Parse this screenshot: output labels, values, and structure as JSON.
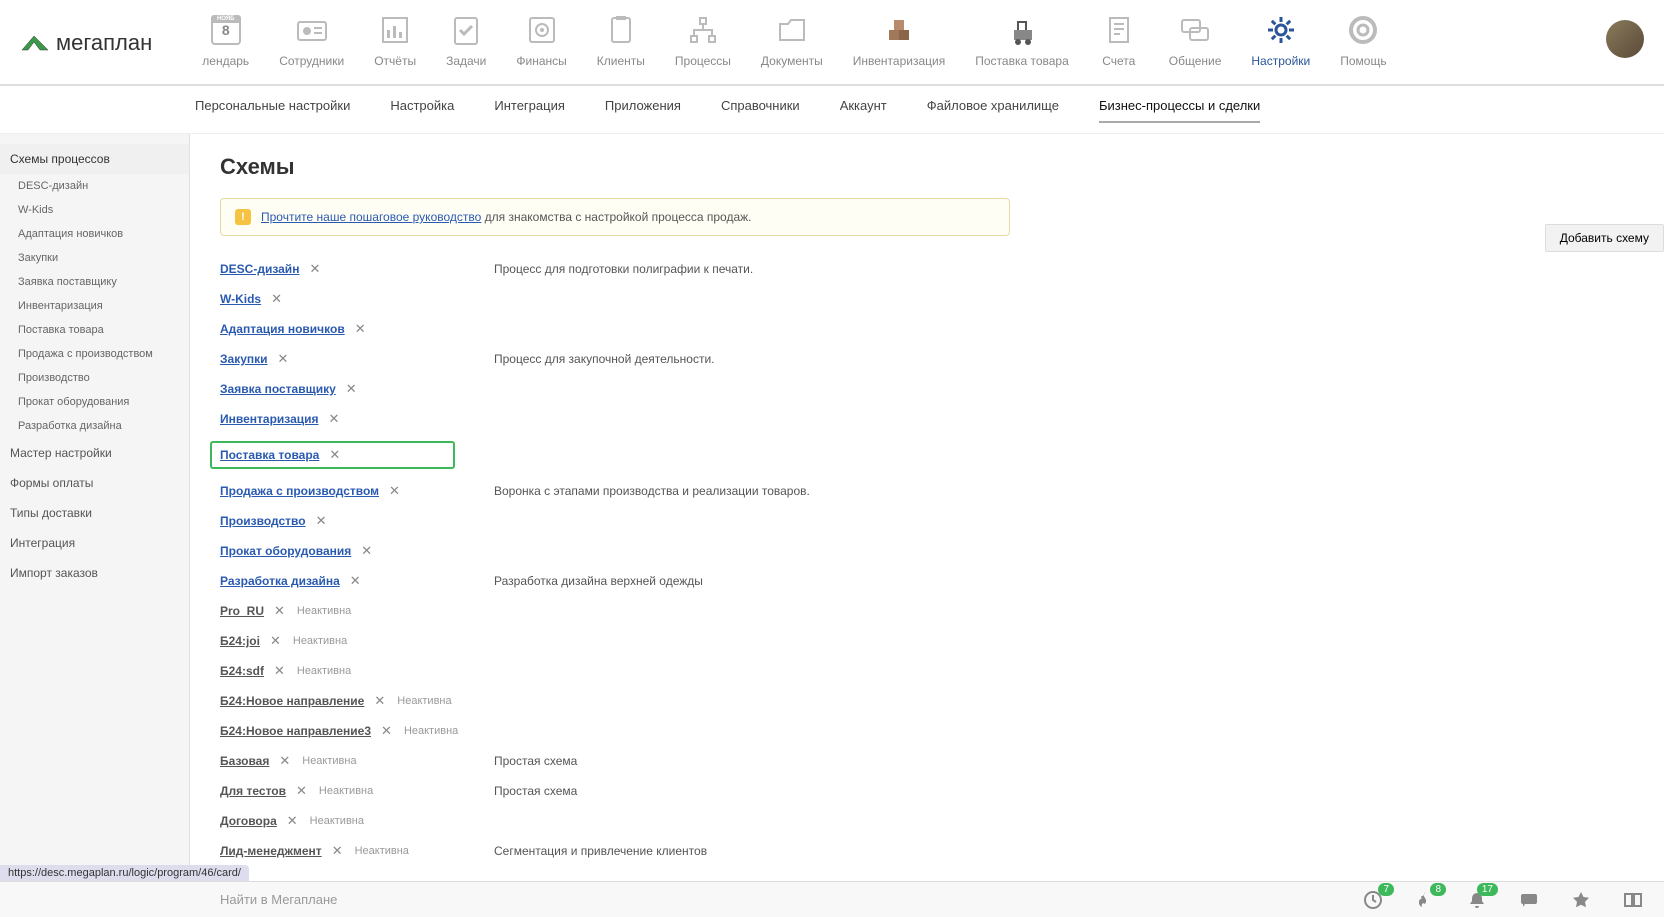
{
  "logo_text": "мегаплан",
  "topnav": [
    {
      "label": "лендарь",
      "icon": "calendar",
      "day": "8"
    },
    {
      "label": "Сотрудники",
      "icon": "badge"
    },
    {
      "label": "Отчёты",
      "icon": "chart"
    },
    {
      "label": "Задачи",
      "icon": "check"
    },
    {
      "label": "Финансы",
      "icon": "safe"
    },
    {
      "label": "Клиенты",
      "icon": "book"
    },
    {
      "label": "Процессы",
      "icon": "tree"
    },
    {
      "label": "Документы",
      "icon": "folder"
    },
    {
      "label": "Инвентаризация",
      "icon": "boxes"
    },
    {
      "label": "Поставка товара",
      "icon": "cart"
    },
    {
      "label": "Счета",
      "icon": "bill"
    },
    {
      "label": "Общение",
      "icon": "chat"
    },
    {
      "label": "Настройки",
      "icon": "gear",
      "active": true
    },
    {
      "label": "Помощь",
      "icon": "help"
    }
  ],
  "subnav": [
    "Персональные настройки",
    "Настройка",
    "Интеграция",
    "Приложения",
    "Справочники",
    "Аккаунт",
    "Файловое хранилище",
    "Бизнес-процессы и сделки"
  ],
  "subnav_active": 7,
  "sidebar": {
    "top": "Схемы процессов",
    "items": [
      "DESC-дизайн",
      "W-Kids",
      "Адаптация новичков",
      "Закупки",
      "Заявка поставщику",
      "Инвентаризация",
      "Поставка товара",
      "Продажа с производством",
      "Производство",
      "Прокат оборудования",
      "Разработка дизайна"
    ],
    "sections": [
      "Мастер настройки",
      "Формы оплаты",
      "Типы доставки",
      "Интеграция",
      "Импорт заказов"
    ]
  },
  "page_title": "Схемы",
  "notice": {
    "link": "Прочтите наше пошаговое руководство",
    "text": " для знакомства с настройкой процесса продаж."
  },
  "add_button": "Добавить схему",
  "schemes": [
    {
      "name": "DESC-дизайн",
      "active": true,
      "desc": "Процесс для подготовки полиграфии к печати."
    },
    {
      "name": "W-Kids",
      "active": true
    },
    {
      "name": "Адаптация новичков",
      "active": true
    },
    {
      "name": "Закупки",
      "active": true,
      "desc": "Процесс для закупочной деятельности."
    },
    {
      "name": "Заявка поставщику",
      "active": true
    },
    {
      "name": "Инвентаризация",
      "active": true
    },
    {
      "name": "Поставка товара",
      "active": true,
      "highlight": true
    },
    {
      "name": "Продажа с производством",
      "active": true,
      "desc": "Воронка с этапами производства и реализации товаров."
    },
    {
      "name": "Производство",
      "active": true
    },
    {
      "name": "Прокат оборудования",
      "active": true
    },
    {
      "name": "Разработка дизайна",
      "active": true,
      "desc": "Разработка дизайна верхней одежды"
    },
    {
      "name": "Pro_RU",
      "active": false,
      "status": "Неактивна"
    },
    {
      "name": "Б24:joi",
      "active": false,
      "status": "Неактивна"
    },
    {
      "name": "Б24:sdf",
      "active": false,
      "status": "Неактивна"
    },
    {
      "name": "Б24:Новое направление",
      "active": false,
      "status": "Неактивна"
    },
    {
      "name": "Б24:Новое направление3",
      "active": false,
      "status": "Неактивна"
    },
    {
      "name": "Базовая",
      "active": false,
      "status": "Неактивна",
      "desc": "Простая схема"
    },
    {
      "name": "Для тестов",
      "active": false,
      "status": "Неактивна",
      "desc": "Простая схема"
    },
    {
      "name": "Договора",
      "active": false,
      "status": "Неактивна"
    },
    {
      "name": "Лид-менеджмент",
      "active": false,
      "status": "Неактивна",
      "desc": "Сегментация и привлечение клиентов"
    }
  ],
  "footer": {
    "search": "Найти в Мегаплане",
    "badges": {
      "clock": "7",
      "fire": "8",
      "bell": "17"
    }
  },
  "status_url": "https://desc.megaplan.ru/logic/program/46/card/"
}
